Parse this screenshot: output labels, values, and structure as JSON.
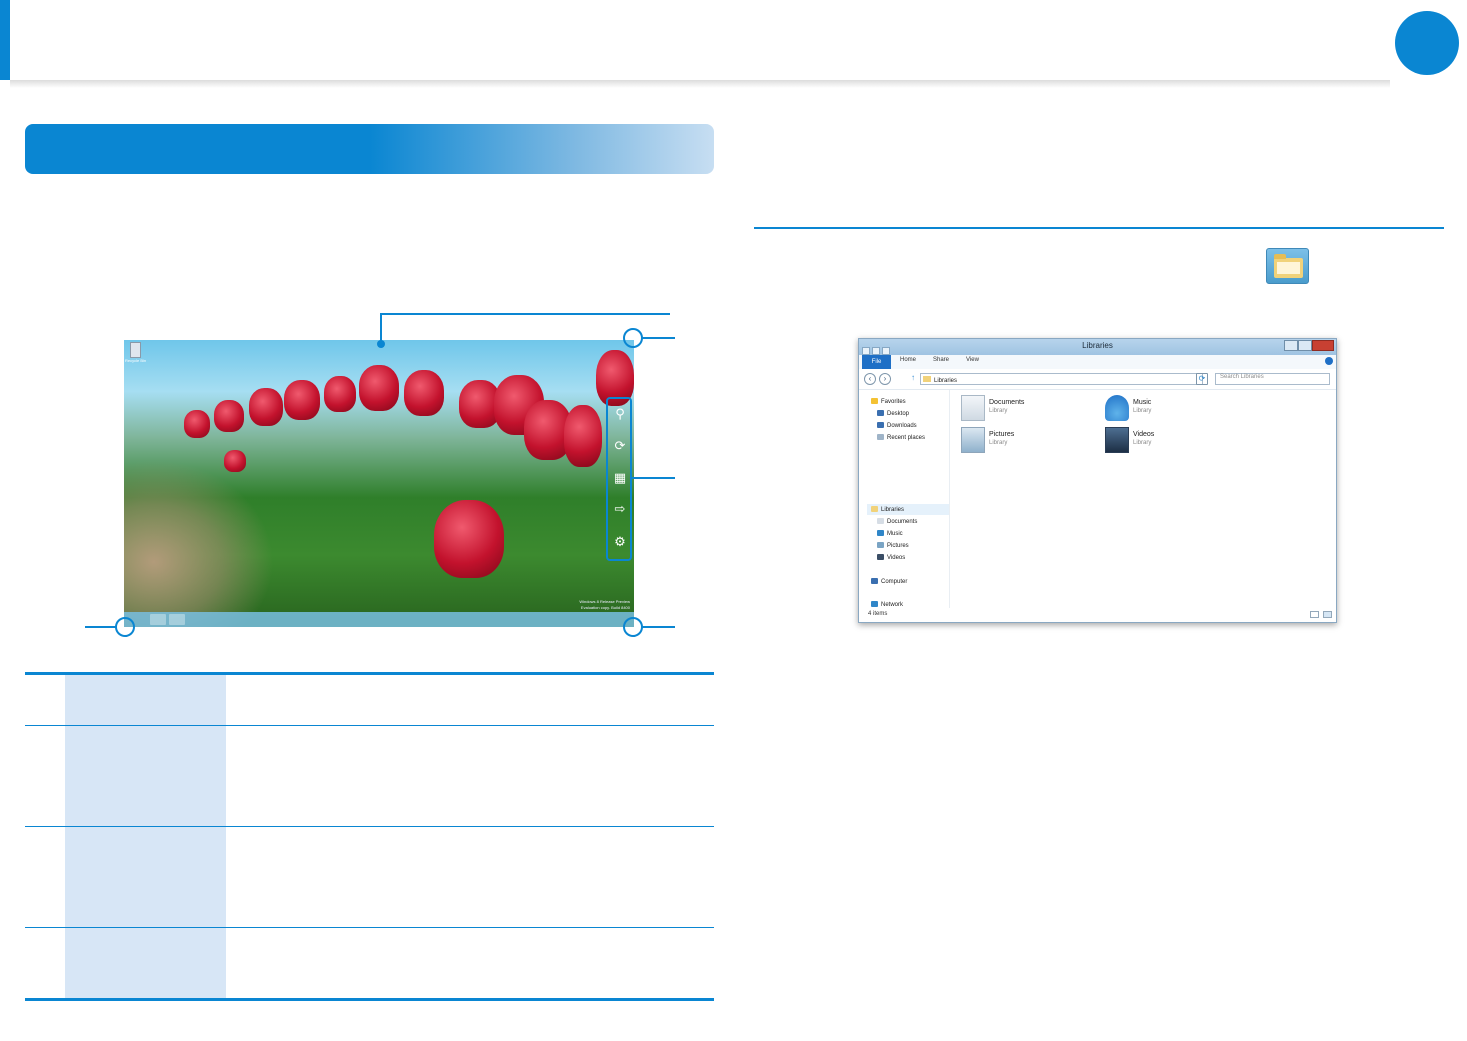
{
  "explorer_window": {
    "title": "Libraries",
    "ribbon_tabs": [
      "File",
      "Home",
      "Share",
      "View"
    ],
    "address_path": "Libraries",
    "search_placeholder": "Search Libraries",
    "navigation": [
      {
        "label": "Favorites",
        "icon": "star-icon"
      },
      {
        "label": "Desktop",
        "icon": "desktop-icon"
      },
      {
        "label": "Downloads",
        "icon": "downloads-icon"
      },
      {
        "label": "Recent places",
        "icon": "recent-places-icon"
      },
      {
        "label": "Libraries",
        "icon": "libraries-icon"
      },
      {
        "label": "Documents",
        "icon": "documents-icon"
      },
      {
        "label": "Music",
        "icon": "music-icon"
      },
      {
        "label": "Pictures",
        "icon": "pictures-icon"
      },
      {
        "label": "Videos",
        "icon": "videos-icon"
      },
      {
        "label": "Computer",
        "icon": "computer-icon"
      },
      {
        "label": "Network",
        "icon": "network-icon"
      }
    ],
    "libraries": [
      {
        "name": "Documents",
        "type": "Library",
        "icon": "documents-library-icon"
      },
      {
        "name": "Music",
        "type": "Library",
        "icon": "music-library-icon"
      },
      {
        "name": "Pictures",
        "type": "Library",
        "icon": "pictures-library-icon"
      },
      {
        "name": "Videos",
        "type": "Library",
        "icon": "videos-library-icon"
      }
    ],
    "status": "4 items"
  },
  "desktop": {
    "recycle_bin_label": "Recycle Bin",
    "watermark_line1": "Windows 8 Release Preview",
    "watermark_line2": "Evaluation copy. Build 8400",
    "charms": [
      "search-charm-icon",
      "share-charm-icon",
      "start-charm-icon",
      "devices-charm-icon",
      "settings-charm-icon"
    ]
  },
  "colors": {
    "accent": "#0a86d2",
    "table_label_column": "#d7e6f6"
  }
}
